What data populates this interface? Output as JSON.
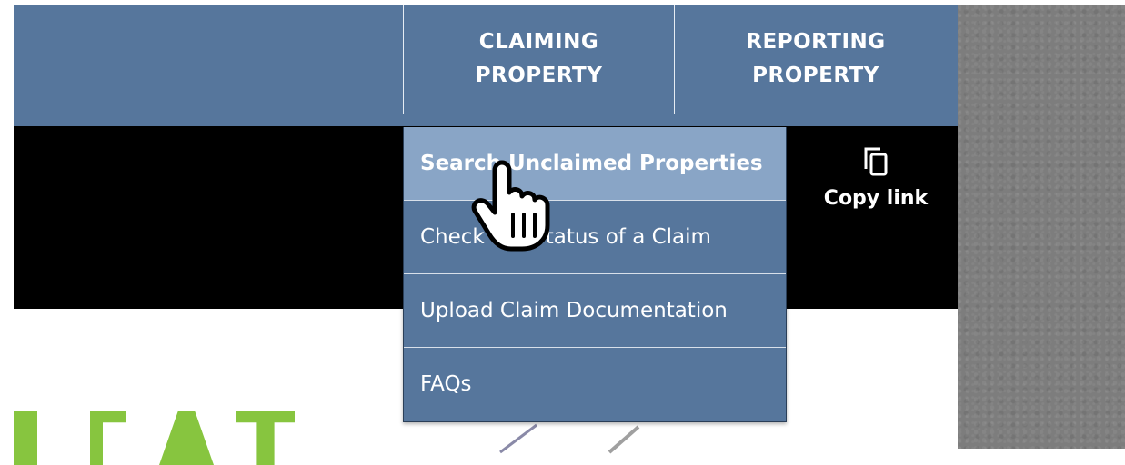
{
  "nav": {
    "claiming": {
      "line1": "CLAIMING",
      "line2": "PROPERTY"
    },
    "reporting": {
      "line1": "REPORTING",
      "line2": "PROPERTY"
    }
  },
  "dropdown": {
    "items": [
      {
        "label": "Search Unclaimed Properties",
        "state": "hovered"
      },
      {
        "label": "Check the Status of a Claim"
      },
      {
        "label": "Upload Claim Documentation"
      },
      {
        "label": "FAQs"
      }
    ]
  },
  "video": {
    "copy_link_label": "Copy link",
    "copy_icon": "copy-icon"
  },
  "cursor": {
    "icon": "hand-pointer-icon"
  },
  "colors": {
    "nav_bg": "#56769c",
    "dropdown_hover": "#89a5c6",
    "video_bg": "#000000",
    "accent_green": "#87c53f",
    "texture": "#7d7d7d"
  }
}
